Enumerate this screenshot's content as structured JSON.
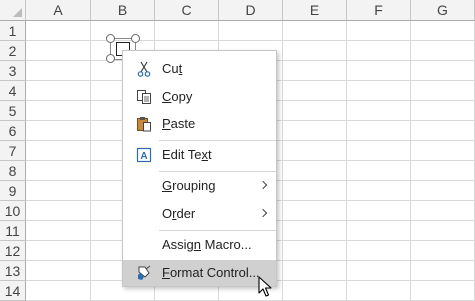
{
  "spreadsheet": {
    "columns": [
      "A",
      "B",
      "C",
      "D",
      "E",
      "F",
      "G"
    ],
    "rows": [
      "1",
      "2",
      "3",
      "4",
      "5",
      "6",
      "7",
      "8",
      "9",
      "10",
      "11",
      "12",
      "13",
      "14"
    ]
  },
  "form_control": {
    "kind": "checkbox",
    "state": "selected"
  },
  "context_menu": {
    "items": [
      {
        "id": "cut",
        "pre": "Cu",
        "key": "t",
        "post": "",
        "icon": "scissors-icon"
      },
      {
        "id": "copy",
        "pre": "",
        "key": "C",
        "post": "opy",
        "icon": "copy-icon"
      },
      {
        "id": "paste",
        "pre": "",
        "key": "P",
        "post": "aste",
        "icon": "paste-icon"
      },
      {
        "id": "edit-text",
        "pre": "Edit Te",
        "key": "x",
        "post": "t",
        "icon": "text-box-icon"
      },
      {
        "id": "grouping",
        "pre": "",
        "key": "G",
        "post": "rouping",
        "submenu": true
      },
      {
        "id": "order",
        "pre": "O",
        "key": "r",
        "post": "der",
        "submenu": true
      },
      {
        "id": "assign-macro",
        "pre": "Assig",
        "key": "n",
        "post": " Macro...",
        "icon": ""
      },
      {
        "id": "format-control",
        "pre": "",
        "key": "F",
        "post": "ormat Control...",
        "icon": "format-brush-icon",
        "highlighted": true
      }
    ]
  },
  "colors": {
    "header_bg": "#f3f3f3",
    "gridline": "#d9d9d9",
    "menu_highlight": "#d0d0d0",
    "icon_blue": "#2b6cb3"
  }
}
